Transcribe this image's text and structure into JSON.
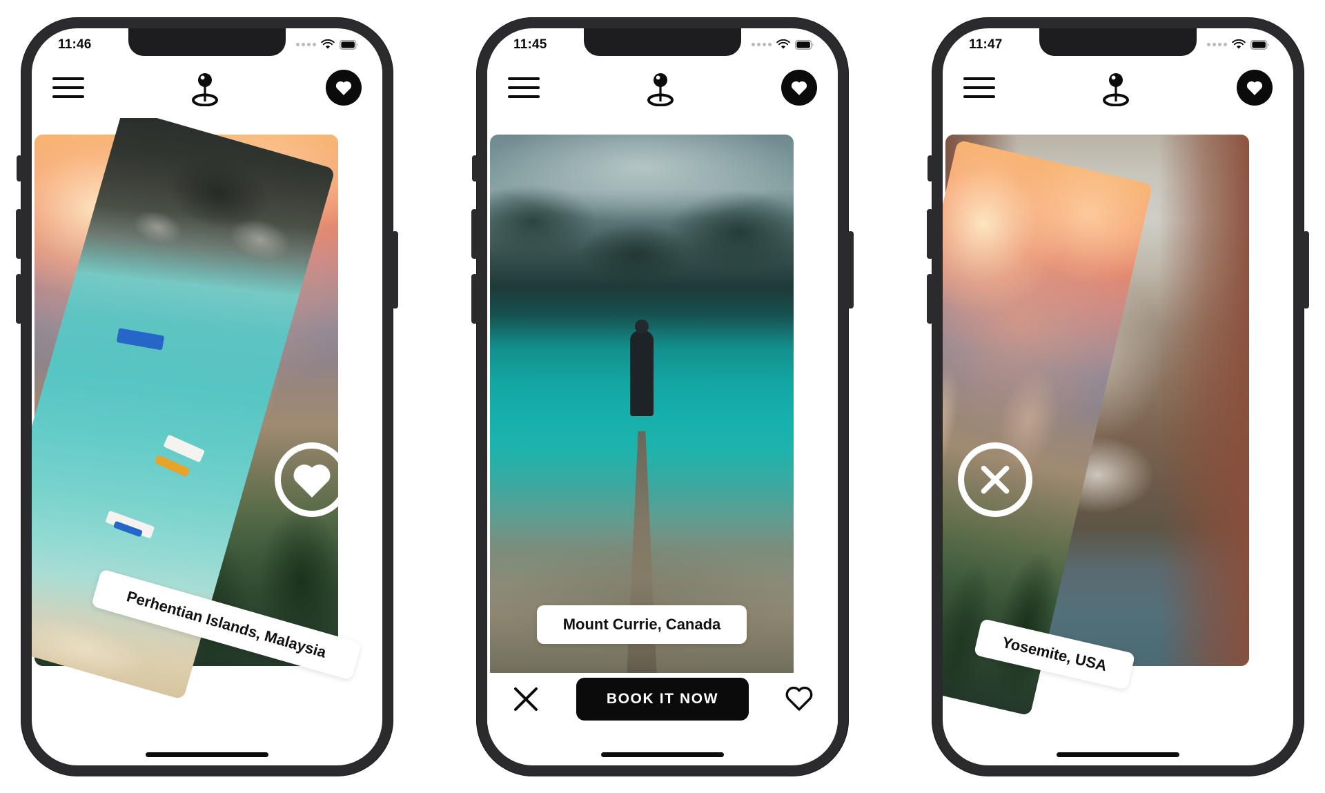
{
  "app": {
    "logo_icon": "map-pin-icon",
    "menu_icon": "hamburger-menu-icon",
    "favorites_icon": "heart-filled-icon"
  },
  "phones": [
    {
      "id": "phone-1",
      "status": {
        "time": "11:46",
        "wifi_icon": "wifi-icon",
        "battery_icon": "battery-icon",
        "signal_icon": "signal-dots-icon"
      },
      "overlay": {
        "action": "like",
        "icon": "heart-filled-icon"
      },
      "cards": [
        {
          "name": "back-card",
          "image": "yosemite-sunset-cliffs"
        },
        {
          "name": "front-card",
          "image": "perhentian-turquoise-aerial",
          "caption": "Perhentian Islands, Malaysia"
        }
      ],
      "action_bar": null
    },
    {
      "id": "phone-2",
      "status": {
        "time": "11:45",
        "wifi_icon": "wifi-icon",
        "battery_icon": "battery-icon",
        "signal_icon": "signal-dots-icon"
      },
      "overlay": null,
      "cards": [
        {
          "name": "front-card",
          "image": "mount-currie-lake",
          "caption": "Mount Currie, Canada"
        }
      ],
      "action_bar": {
        "dismiss_icon": "close-x-icon",
        "book_label": "BOOK IT NOW",
        "like_icon": "heart-outline-icon"
      }
    },
    {
      "id": "phone-3",
      "status": {
        "time": "11:47",
        "wifi_icon": "wifi-icon",
        "battery_icon": "battery-icon",
        "signal_icon": "signal-dots-icon"
      },
      "overlay": {
        "action": "dismiss",
        "icon": "close-x-icon"
      },
      "cards": [
        {
          "name": "back-card",
          "image": "venice-canal"
        },
        {
          "name": "front-card",
          "image": "yosemite-sunset-cliffs",
          "caption": "Yosemite, USA"
        }
      ],
      "action_bar": null
    }
  ],
  "colors": {
    "accent": "#0b0b0b",
    "surface": "#ffffff",
    "phone_frame": "#2b2b2d",
    "notch": "#1d1d1f"
  }
}
